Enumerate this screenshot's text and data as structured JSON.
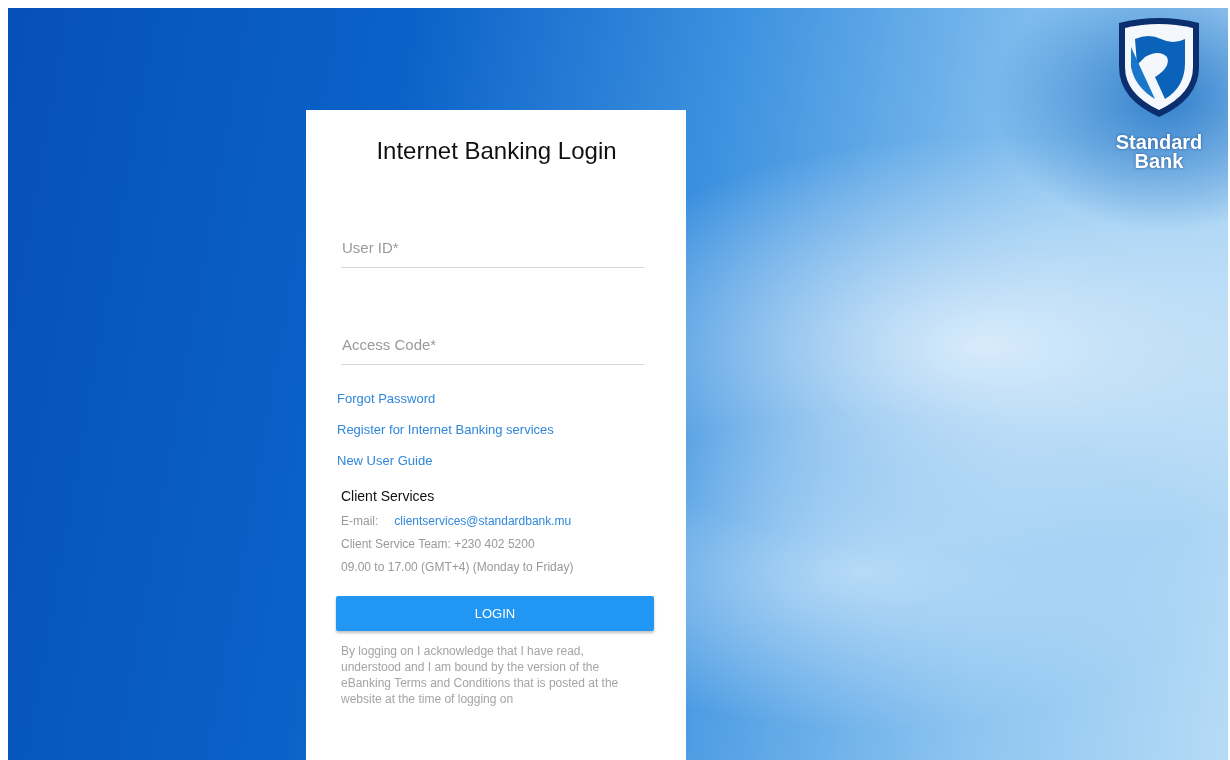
{
  "login_card": {
    "title": "Internet Banking Login",
    "fields": [
      {
        "placeholder": "User ID*"
      },
      {
        "placeholder": "Access Code*"
      }
    ],
    "links": [
      "Forgot Password",
      "Register for Internet Banking services",
      "New User Guide"
    ],
    "client_services": {
      "heading": "Client Services",
      "email_label": "E-mail:",
      "email": "clientservices@standardbank.mu",
      "phone": "Client Service Team: +230 402 5200",
      "hours": "09.00 to 17.00 (GMT+4) (Monday to Friday)"
    },
    "button": "LOGIN",
    "disclaimer": "By logging on I acknowledge that I have read, understood and I am bound by the version of the eBanking Terms and Conditions that is posted at the website at the time of logging on"
  },
  "brand": {
    "name": "Standard Bank"
  }
}
